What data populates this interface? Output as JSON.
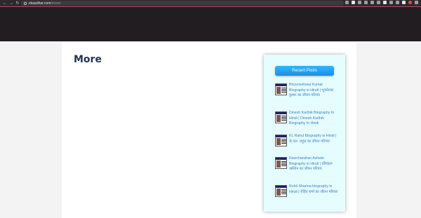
{
  "browser": {
    "url_host": "ekaadhar.com",
    "url_path": "/more/"
  },
  "page": {
    "title": "More"
  },
  "sidebar": {
    "heading": "Recent Posts",
    "posts": [
      {
        "title": "Bhuvneshwar Kumar Biography in Hindi | भुवनेश्वर कुमार का जीवन परिचय"
      },
      {
        "title": "Dinesh Karthik Biography In Hindi | Dinesh Karthik Biography In Hindi"
      },
      {
        "title": "KL Rahul Biography in Hindi | के.एल. राहुल का जीवन परिचय"
      },
      {
        "title": "Ravichandran Ashwin Biography in Hindi | रविचंद्रन अश्विन का जीवन परिचय"
      },
      {
        "title": "Rohit Sharma biography in Hindi | रोहित शर्मा का जीवन परिचय"
      }
    ]
  }
}
